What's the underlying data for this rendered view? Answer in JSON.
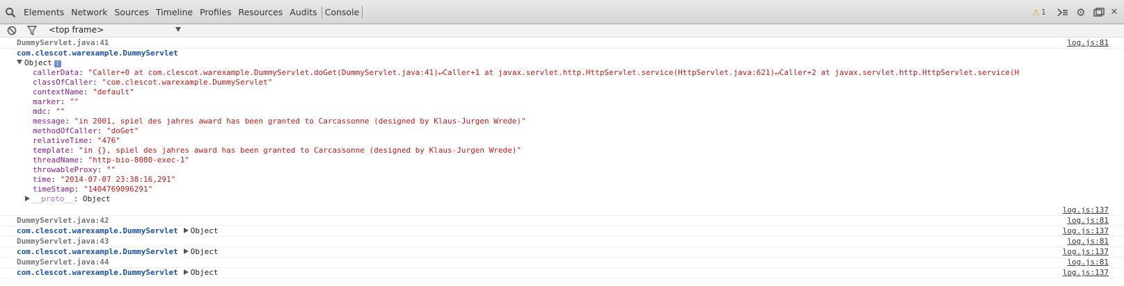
{
  "toolbar": {
    "tabs": [
      "Elements",
      "Network",
      "Sources",
      "Timeline",
      "Profiles",
      "Resources",
      "Audits",
      "Console"
    ],
    "warning_count": "1"
  },
  "filter": {
    "frame": "<top frame>"
  },
  "messages": [
    {
      "location": "DummyServlet.java:41",
      "location_src": "log.js:81",
      "logger": "com.clescot.warexample.DummyServlet",
      "object_label": "Object",
      "props": [
        {
          "key": "callerData",
          "value": "\"Caller+0    at com.clescot.warexample.DummyServlet.doGet(DummyServlet.java:41)↵Caller+1     at javax.servlet.http.HttpServlet.service(HttpServlet.java:621)↵Caller+2    at javax.servlet.http.HttpServlet.service(H"
        },
        {
          "key": "classOfCaller",
          "value": "\"com.clescot.warexample.DummyServlet\""
        },
        {
          "key": "contextName",
          "value": "\"default\""
        },
        {
          "key": "marker",
          "value": "\"\""
        },
        {
          "key": "mdc",
          "value": "\"\""
        },
        {
          "key": "message",
          "value": "\"in 2001, spiel des jahres award has been granted to Carcassonne (designed by Klaus-Jurgen Wrede)\""
        },
        {
          "key": "methodOfCaller",
          "value": "\"doGet\""
        },
        {
          "key": "relativeTime",
          "value": "\"476\""
        },
        {
          "key": "template",
          "value": "\"in {}, spiel des jahres award has been granted to Carcassonne (designed by Klaus-Jurgen Wrede)\""
        },
        {
          "key": "threadName",
          "value": "\"http-bio-8080-exec-1\""
        },
        {
          "key": "throwableProxy",
          "value": "\"\""
        },
        {
          "key": "time",
          "value": "\"2014-07-07 23:38:16,291\""
        },
        {
          "key": "timeStamp",
          "value": "\"1404769096291\""
        }
      ],
      "proto_key": "__proto__",
      "proto_value": "Object",
      "object_src": "log.js:137"
    },
    {
      "location": "DummyServlet.java:42",
      "location_src": "log.js:81",
      "logger": "com.clescot.warexample.DummyServlet",
      "object_label": "Object",
      "object_src": "log.js:137"
    },
    {
      "location": "DummyServlet.java:43",
      "location_src": "log.js:81",
      "logger": "com.clescot.warexample.DummyServlet",
      "object_label": "Object",
      "object_src": "log.js:137"
    },
    {
      "location": "DummyServlet.java:44",
      "location_src": "log.js:81",
      "logger": "com.clescot.warexample.DummyServlet",
      "object_label": "Object",
      "object_src": "log.js:137"
    }
  ]
}
